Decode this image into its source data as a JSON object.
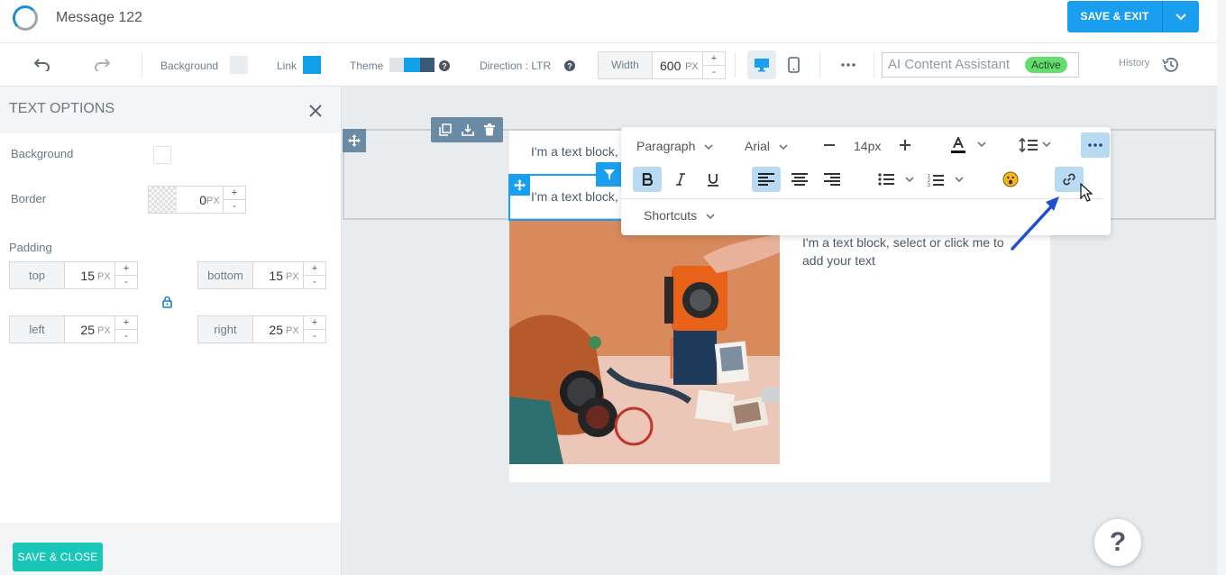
{
  "header": {
    "title": "Message 122",
    "save_exit_label": "SAVE & EXIT"
  },
  "toolbar": {
    "background_label": "Background",
    "link_label": "Link",
    "theme_label": "Theme",
    "direction_label": "Direction : LTR",
    "width_label": "Width",
    "width_value": "600",
    "width_unit": "PX",
    "ai_label": "AI Content Assistant",
    "ai_status": "Active",
    "history_label": "History",
    "colors": {
      "background_swatch": "#e9edf0",
      "link_swatch": "#12a0e8",
      "theme_a": "#e0e4e7",
      "theme_b": "#12a0e8",
      "theme_c": "#3c5a75"
    }
  },
  "text_options": {
    "title": "TEXT OPTIONS",
    "background_label": "Background",
    "border_label": "Border",
    "border_value": "0",
    "unit": "PX",
    "padding_label": "Padding",
    "padding": {
      "top_label": "top",
      "top_value": "15",
      "bottom_label": "bottom",
      "bottom_value": "15",
      "left_label": "left",
      "left_value": "25",
      "right_label": "right",
      "right_value": "25"
    },
    "save_close_label": "SAVE & CLOSE"
  },
  "canvas": {
    "text_block_1": "I'm a text block,",
    "text_block_2": "I'm a text block,",
    "text_block_3": "I'm a text block, select or click me to add your text",
    "help_label": "?"
  },
  "text_toolbar": {
    "format_value": "Paragraph",
    "font_value": "Arial",
    "size_value": "14px",
    "shortcuts_label": "Shortcuts"
  }
}
